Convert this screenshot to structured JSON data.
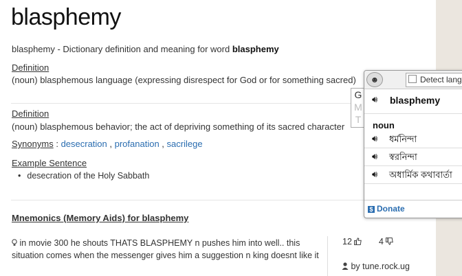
{
  "title": "blasphemy",
  "subtitle_prefix": "blasphemy - Dictionary definition and meaning for word ",
  "subtitle_word": "blasphemy",
  "definitions": [
    {
      "label": "Definition",
      "text": "(noun) blasphemous language (expressing disrespect for God or for something sacred)"
    },
    {
      "label": "Definition",
      "text": "(noun) blasphemous behavior; the act of depriving something of its sacred character"
    }
  ],
  "synonyms": {
    "label": "Synonyms",
    "items": [
      "desecration",
      "profanation",
      "sacrilege"
    ]
  },
  "example": {
    "label": "Example Sentence",
    "items": [
      "desecration of the Holy Sabbath"
    ]
  },
  "mnemonics": {
    "title": "Mnemonics (Memory Aids) for blasphemy",
    "text": "in movie 300 he shouts THATS BLASPHEMY n pushes him into well.. this situation comes when the messenger gives him a suggestion n king doesnt like it",
    "upvotes": "12",
    "downvotes": "4",
    "author": "by tune.rock.ug"
  },
  "popup": {
    "detect_label": "Detect langu",
    "gmt": [
      "G",
      "M",
      "T"
    ],
    "word": "blasphemy",
    "pos": "noun",
    "translations": [
      "ধর্মনিন্দা",
      "স্বরনিন্দা",
      "অধার্মিক কথাবার্তা"
    ],
    "donate": "Donate"
  },
  "colors": {
    "link": "#2a6db0",
    "background_side": "#ebe6df"
  }
}
